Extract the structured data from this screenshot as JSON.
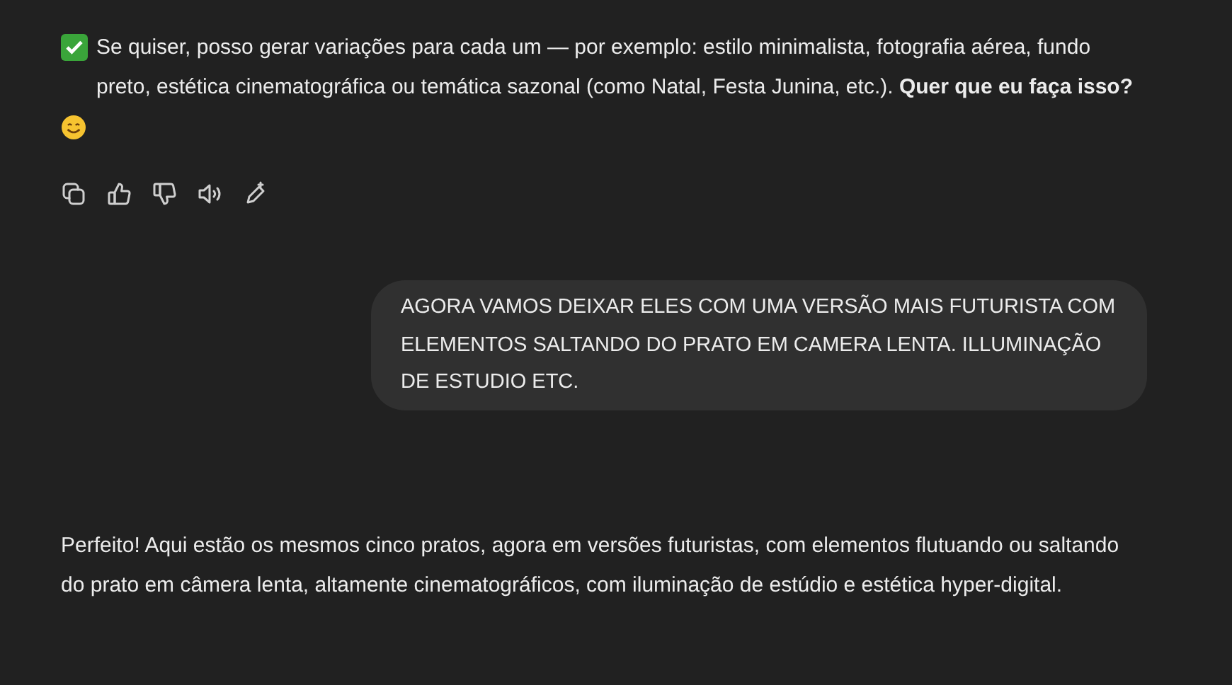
{
  "messages": [
    {
      "kind": "reply",
      "text": "Se quiser, posso gerar variações para cada um — por exemplo: estilo minimalista, fotografia aérea, fundo preto, estética cinematográfica ou temática sazonal (como Natal, Festa Junina, etc.). **Quer que eu faça isso?**",
      "actions": true
    },
    {
      "kind": "prompt",
      "text": "AGORA VAMOS DEIXAR ELES COM UMA VERSÃO MAIS FUTURISTA COM ELEMENTOS SALTANDO DO PRATO EM CAMERA LENTA. ILLUMINAÇÃO DE ESTUDIO ETC."
    },
    {
      "kind": "reply",
      "text": "Perfeito! Aqui estão os mesmos cinco pratos, agora em versões futuristas, com elementos flutuando ou saltando do prato em câmera lenta, altamente cinematográficos, com iluminação de estúdio e estética hyper-digital.",
      "actions": false
    }
  ]
}
